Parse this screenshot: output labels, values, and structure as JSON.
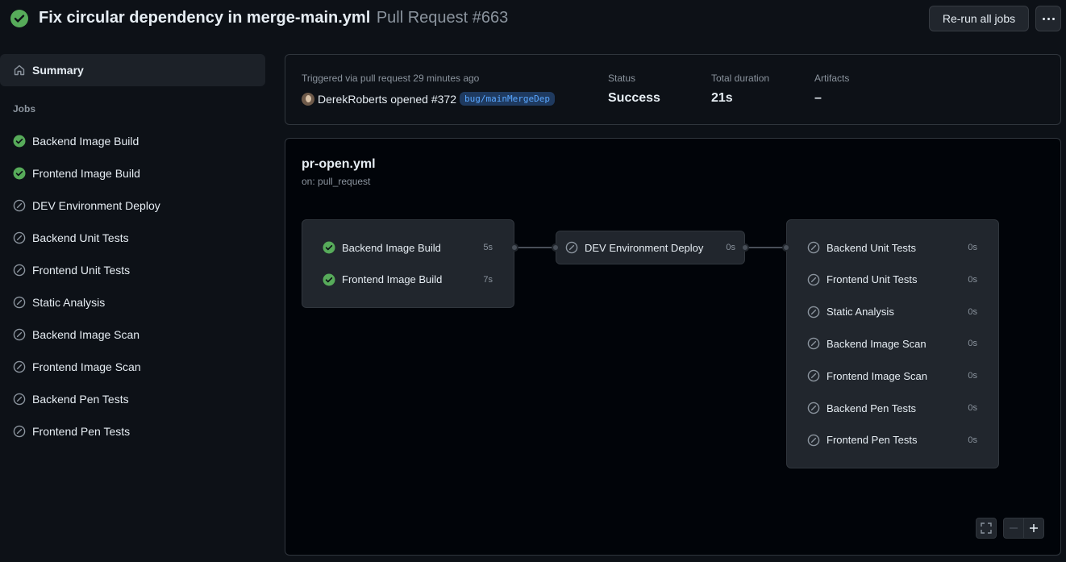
{
  "header": {
    "title": "Fix circular dependency in merge-main.yml",
    "subtitle": "Pull Request #663",
    "rerun_label": "Re-run all jobs"
  },
  "sidebar": {
    "summary_label": "Summary",
    "jobs_heading": "Jobs",
    "items": [
      {
        "label": "Backend Image Build",
        "status": "success"
      },
      {
        "label": "Frontend Image Build",
        "status": "success"
      },
      {
        "label": "DEV Environment Deploy",
        "status": "skipped"
      },
      {
        "label": "Backend Unit Tests",
        "status": "skipped"
      },
      {
        "label": "Frontend Unit Tests",
        "status": "skipped"
      },
      {
        "label": "Static Analysis",
        "status": "skipped"
      },
      {
        "label": "Backend Image Scan",
        "status": "skipped"
      },
      {
        "label": "Frontend Image Scan",
        "status": "skipped"
      },
      {
        "label": "Backend Pen Tests",
        "status": "skipped"
      },
      {
        "label": "Frontend Pen Tests",
        "status": "skipped"
      }
    ]
  },
  "summary": {
    "triggered_label": "Triggered via pull request 29 minutes ago",
    "actor_line": "DerekRoberts opened #372",
    "branch": "bug/mainMergeDep",
    "status_label": "Status",
    "status_value": "Success",
    "duration_label": "Total duration",
    "duration_value": "21s",
    "artifacts_label": "Artifacts",
    "artifacts_value": "–"
  },
  "graph": {
    "workflow_name": "pr-open.yml",
    "trigger": "on: pull_request",
    "group1": [
      {
        "label": "Backend Image Build",
        "duration": "5s",
        "status": "success"
      },
      {
        "label": "Frontend Image Build",
        "duration": "7s",
        "status": "success"
      }
    ],
    "group2": [
      {
        "label": "DEV Environment Deploy",
        "duration": "0s",
        "status": "skipped"
      }
    ],
    "group3": [
      {
        "label": "Backend Unit Tests",
        "duration": "0s",
        "status": "skipped"
      },
      {
        "label": "Frontend Unit Tests",
        "duration": "0s",
        "status": "skipped"
      },
      {
        "label": "Static Analysis",
        "duration": "0s",
        "status": "skipped"
      },
      {
        "label": "Backend Image Scan",
        "duration": "0s",
        "status": "skipped"
      },
      {
        "label": "Frontend Image Scan",
        "duration": "0s",
        "status": "skipped"
      },
      {
        "label": "Backend Pen Tests",
        "duration": "0s",
        "status": "skipped"
      },
      {
        "label": "Frontend Pen Tests",
        "duration": "0s",
        "status": "skipped"
      }
    ]
  },
  "colors": {
    "success": "#57ab5a",
    "skipped": "#8b949e"
  },
  "icons": {
    "success": "check-circle-fill-icon",
    "skipped": "skip-icon",
    "summary": "home-icon",
    "more": "kebab-horizontal-icon",
    "fullscreen": "screen-full-icon",
    "zoom_out": "dash-icon",
    "zoom_in": "plus-icon"
  }
}
